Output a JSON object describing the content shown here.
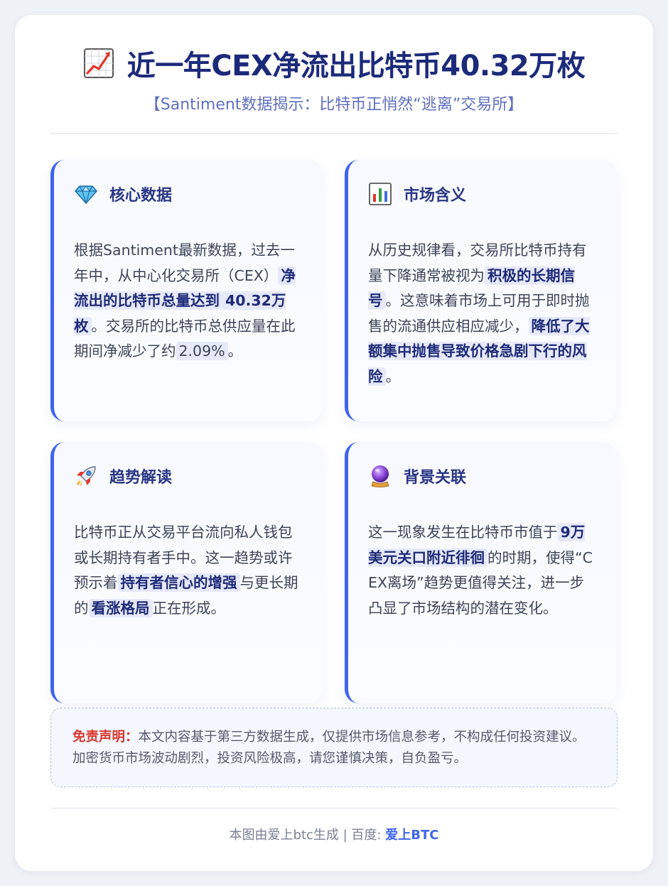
{
  "header": {
    "title_icon": "chart-increasing-icon",
    "title": "近一年CEX净流出比特币40.32万枚",
    "subtitle": "【Santiment数据揭示：比特币正悄然“逃离”交易所】"
  },
  "cards": [
    {
      "icon": "gem-icon",
      "title": "核心数据",
      "body": [
        {
          "t": "根据Santiment最新数据，过去一年中，从中心化交易所（CEX）"
        },
        {
          "t": "净流出的比特币总量达到",
          "hl": true
        },
        {
          "t": "40.32万枚",
          "hl": true
        },
        {
          "t": "。交易所的比特币总供应量在此期间净减少了约"
        },
        {
          "t": "2.09%",
          "num": true
        },
        {
          "t": "。"
        }
      ]
    },
    {
      "icon": "bar-chart-icon",
      "title": "市场含义",
      "body": [
        {
          "t": "从历史规律看，交易所比特币持有量下降通常被视为"
        },
        {
          "t": "积极的长期信号",
          "hl": true
        },
        {
          "t": "。这意味着市场上可用于即时抛售的流通供应相应减少，"
        },
        {
          "t": "降低了大额集中抛售导致价格急剧下行的风险",
          "hl": true
        },
        {
          "t": "。"
        }
      ]
    },
    {
      "icon": "rocket-icon",
      "title": "趋势解读",
      "body": [
        {
          "t": "比特币正从交易平台流向私人钱包或长期持有者手中。这一趋势或许预示着"
        },
        {
          "t": "持有者信心的增强",
          "hl": true
        },
        {
          "t": "与更长期的"
        },
        {
          "t": "看涨格局",
          "hl": true
        },
        {
          "t": "正在形成。"
        }
      ]
    },
    {
      "icon": "crystal-ball-icon",
      "title": "背景关联",
      "body": [
        {
          "t": "这一现象发生在比特币市值于"
        },
        {
          "t": "9万美元关口附近徘徊",
          "hl": true
        },
        {
          "t": "的时期，使得“CEX离场”趋势更值得关注，进一步凸显了市场结构的潜在变化。"
        }
      ]
    }
  ],
  "disclaimer": {
    "label": "免责声明：",
    "text": "本文内容基于第三方数据生成，仅提供市场信息参考，不构成任何投资建议。加密货币市场波动剧烈，投资风险极高，请您谨慎决策，自负盈亏。"
  },
  "footer": {
    "text": "本图由爱上btc生成 | 百度: ",
    "link": "爱上BTC"
  },
  "colors": {
    "accent": "#3f64f0",
    "title": "#1c2a7a",
    "subtitle": "#5f6fc0",
    "disclaimer_label": "#d9372f"
  }
}
